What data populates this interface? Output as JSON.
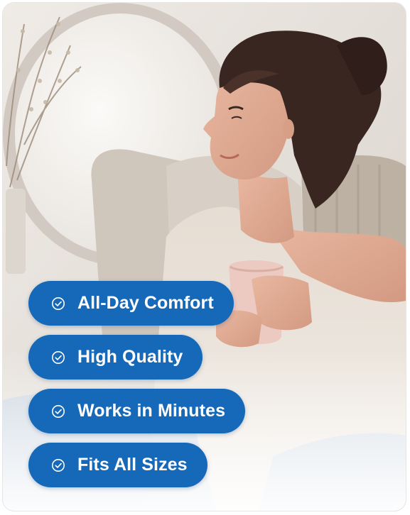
{
  "benefits": [
    {
      "label": "All-Day Comfort",
      "icon": "check-circle-icon"
    },
    {
      "label": "High Quality",
      "icon": "check-circle-icon"
    },
    {
      "label": "Works in Minutes",
      "icon": "check-circle-icon"
    },
    {
      "label": "Fits All Sizes",
      "icon": "check-circle-icon"
    }
  ],
  "colors": {
    "pill_background": "#1668b8",
    "pill_text": "#ffffff"
  }
}
